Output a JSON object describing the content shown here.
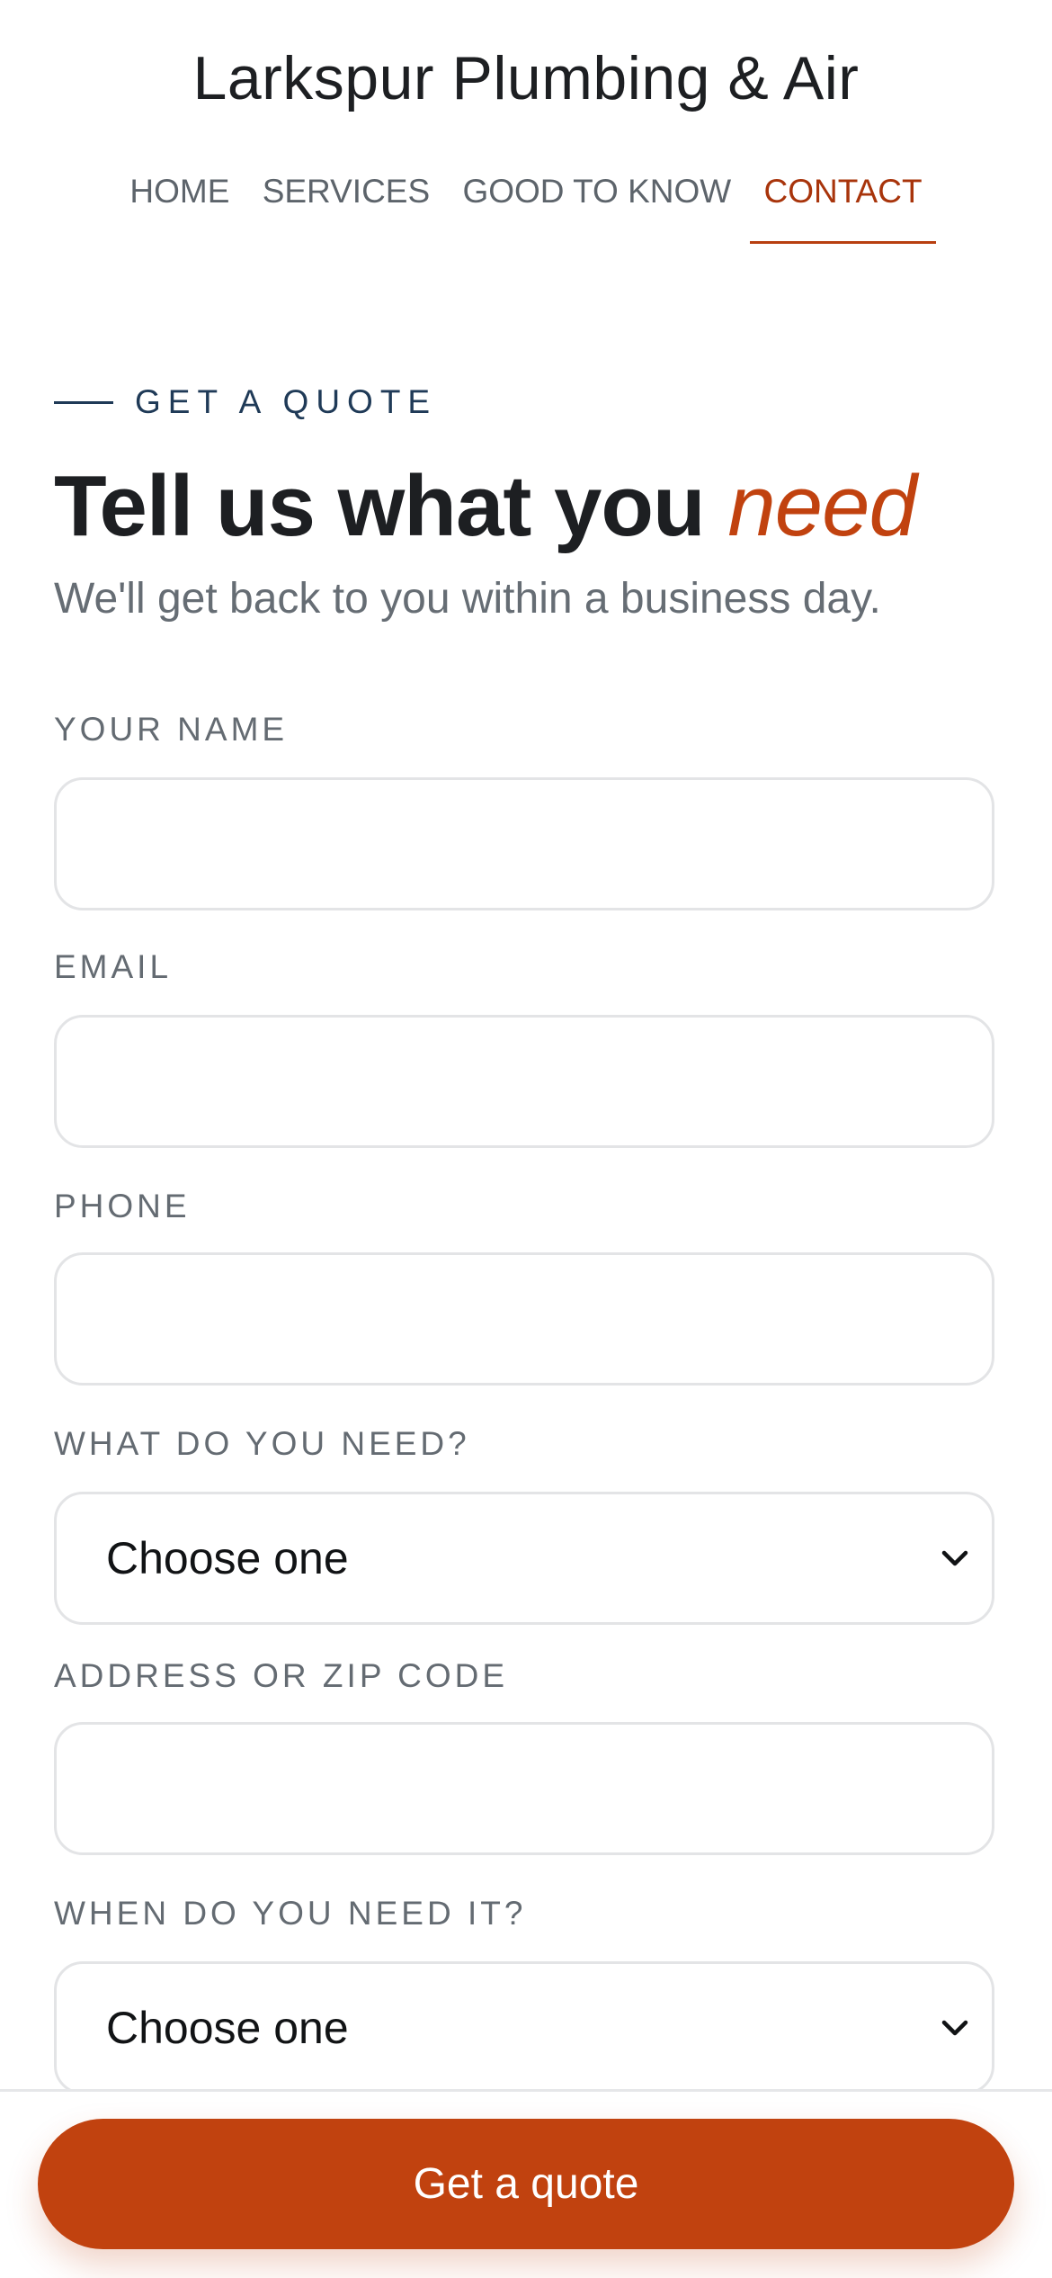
{
  "header": {
    "title": "Larkspur Plumbing & Air",
    "nav": [
      {
        "label": "HOME",
        "active": false
      },
      {
        "label": "SERVICES",
        "active": false
      },
      {
        "label": "GOOD TO KNOW",
        "active": false
      },
      {
        "label": "CONTACT",
        "active": true
      }
    ]
  },
  "intro": {
    "eyebrow": "GET A QUOTE",
    "heading": "Tell us what you",
    "heading_accent": "need",
    "subheading": "We'll get back to you within a business day."
  },
  "form": {
    "name": {
      "label": "YOUR NAME",
      "value": ""
    },
    "email": {
      "label": "EMAIL",
      "value": ""
    },
    "phone": {
      "label": "PHONE",
      "value": ""
    },
    "service": {
      "label": "WHAT DO YOU NEED?",
      "value": "Choose one"
    },
    "address": {
      "label": "ADDRESS OR ZIP CODE",
      "value": ""
    },
    "timing": {
      "label": "WHEN DO YOU NEED IT?",
      "value": "Choose one"
    }
  },
  "cta": {
    "label": "Get a quote"
  },
  "colors": {
    "accent": "#c1420f",
    "nav_active": "#a8340b",
    "eyebrow": "#1f3a57",
    "muted_text": "#666d74",
    "field_border": "#e3e4e6"
  },
  "icons": {
    "select_arrow": "chevron-down-icon"
  }
}
